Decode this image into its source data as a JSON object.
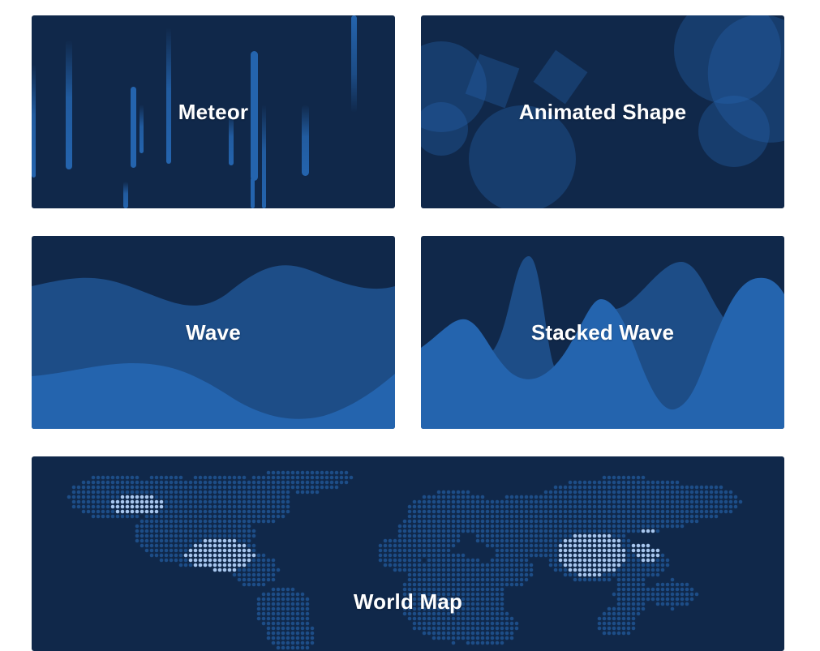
{
  "cards": [
    {
      "id": "meteor",
      "title": "Meteor"
    },
    {
      "id": "animated-shape",
      "title": "Animated Shape"
    },
    {
      "id": "wave",
      "title": "Wave"
    },
    {
      "id": "stacked-wave",
      "title": "Stacked Wave"
    },
    {
      "id": "world-map",
      "title": "World Map"
    }
  ],
  "colors": {
    "background_dark": "#10284a",
    "accent_mid": "#1d4d87",
    "accent_light": "#2464ae",
    "highlight": "#a7c6ee"
  }
}
